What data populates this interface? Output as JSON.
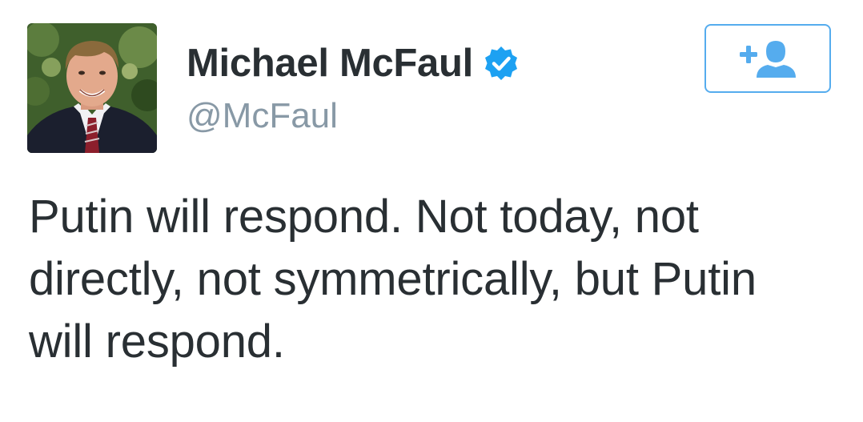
{
  "tweet": {
    "author": {
      "display_name": "Michael McFaul",
      "handle": "@McFaul",
      "verified": true,
      "avatar_icon": "profile-photo"
    },
    "follow_button": {
      "icon": "add-user-icon",
      "accent_color": "#55acee"
    },
    "text_lines": [
      "Putin will respond. Not today, not",
      "directly, not symmetrically, but Putin",
      "will respond."
    ]
  },
  "colors": {
    "name": "#292f33",
    "handle": "#8899a6",
    "accent": "#55acee",
    "verified": "#1da1f2"
  }
}
